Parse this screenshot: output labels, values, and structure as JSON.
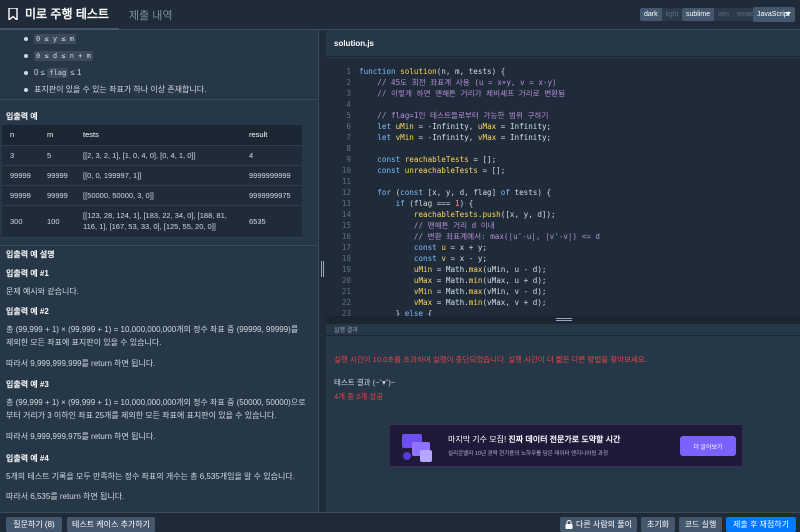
{
  "header": {
    "active_tab": "미로 주행 테스트",
    "inactive_tab": "제출 내역",
    "theme_dark": "dark",
    "theme_light": "light",
    "editor_sublime": "sublime",
    "editor_vim": "vim",
    "editor_emacs": "emacs",
    "language": "JavaScript"
  },
  "constraints": {
    "item1": "0 ≤ y ≤ m",
    "item2": "0 ≤ d ≤ n + m",
    "item3_prefix": "0 ≤ ",
    "item3_code": "flag",
    "item3_suffix": " ≤ 1",
    "item4": "표지판이 있을 수 있는 좌표가 하나 이상 존재합니다."
  },
  "io_example": {
    "title": "입출력 예",
    "headers": [
      "n",
      "m",
      "tests",
      "result"
    ],
    "rows": [
      [
        "3",
        "5",
        "[[2, 3, 2, 1], [1, 0, 4, 0], [0, 4, 1, 0]]",
        "4"
      ],
      [
        "99999",
        "99999",
        "[[0, 0, 199997, 1]]",
        "9999999999"
      ],
      [
        "99999",
        "99999",
        "[[50000, 50000, 3, 0]]",
        "9999999975"
      ],
      [
        "300",
        "100",
        "[[123, 28, 124, 1], [183, 22, 34, 0], [188, 81, 116, 1], [167, 53, 33, 0], [125, 55, 20, 0]]",
        "6535"
      ]
    ]
  },
  "explanation": {
    "title": "입출력 예 설명",
    "ex1_title": "입출력 예 #1",
    "ex1_text": "문제 예시와 같습니다.",
    "ex2_title": "입출력 예 #2",
    "ex2_text1": "총 (99,999 + 1) × (99,999 + 1) = 10,000,000,000개의 정수 좌표 중 (99999, 99999)를 제외한 모든 좌표에 표지판이 있을 수 있습니다.",
    "ex2_text2": "따라서 9,999,999,999를 return 하면 됩니다.",
    "ex3_title": "입출력 예 #3",
    "ex3_text1": "총 (99,999 + 1) × (99,999 + 1) = 10,000,000,000개의 정수 좌표 중 (50000, 50000)으로부터 거리가 3 이하인 좌표 25개를 제외한 모든 좌표에 표지판이 있을 수 있습니다.",
    "ex3_text2": "따라서 9,999,999,975를 return 하면 됩니다.",
    "ex4_title": "입출력 예 #4",
    "ex4_text1": "5개의 테스트 기록을 모두 만족하는 정수 좌표의 개수는 총 6,535개임을 알 수 있습니다.",
    "ex4_text2": "따라서 6,535를 return 하면 됩니다."
  },
  "editor": {
    "file_name": "solution.js",
    "line_numbers": [
      "1",
      "2",
      "3",
      "4",
      "5",
      "6",
      "7",
      "8",
      "9",
      "10",
      "11",
      "12",
      "13",
      "14",
      "15",
      "16",
      "17",
      "18",
      "19",
      "20",
      "21",
      "22",
      "23",
      "24"
    ]
  },
  "result": {
    "label": "실행 결과",
    "error": "실행 시간이 10.0초를 초과하여 실행이 중단되었습니다. 실행 시간이 더 짧은 다른 방법을 찾아보세요.",
    "test_result": "테스트 결과 (~˘▾˘)~",
    "score": "4개 중 2개 성공"
  },
  "banner": {
    "title_prefix": "마지막 기수 모집! ",
    "title_bold": "진짜 데이터 전문가로 도약할 시간",
    "subtitle": "실리콘밸리 10년 경력 현기용의 노하우를 담은 데이터 엔지니어링 과정",
    "button": "더 알아보기"
  },
  "footer": {
    "question": "질문하기 (8)",
    "add_testcase": "테스트 케이스 추가하기",
    "others_solution": "다른 사람의 풀이",
    "reset": "초기화",
    "run": "코드 실행",
    "submit": "제출 후 채점하기"
  },
  "colors": {
    "background": "#263747",
    "editor_bg": "#1f2b38",
    "keyword": "#7fbbff",
    "comment": "#b68ed8",
    "error": "#e64545",
    "primary": "#0078ff"
  }
}
